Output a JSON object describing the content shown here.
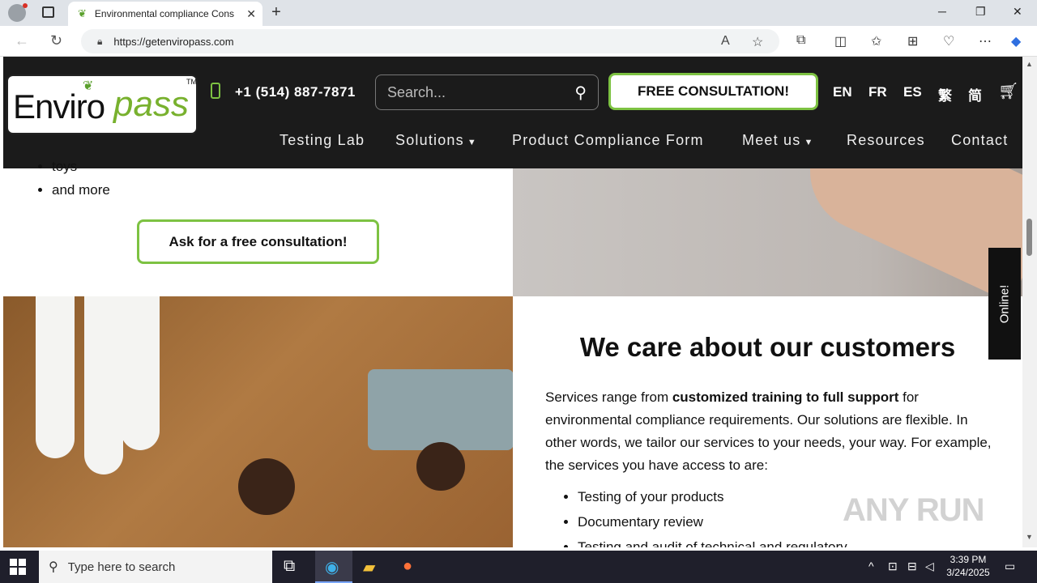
{
  "browser": {
    "tab_title": "Environmental compliance Cons",
    "url": "https://getenviropass.com",
    "tab_close": "✕",
    "new_tab": "+",
    "win_min": "─",
    "win_restore": "❐",
    "win_close": "✕"
  },
  "header": {
    "logo_left": "Enviro",
    "logo_right": "pass",
    "logo_tm": "TM",
    "phone": "+1 (514) 887-7871",
    "search_placeholder": "Search...",
    "cta": "FREE CONSULTATION!",
    "languages": [
      "EN",
      "FR",
      "ES",
      "繁",
      "简"
    ],
    "menu": [
      "Testing Lab",
      "Solutions",
      "Product Compliance Form",
      "Meet us",
      "Resources",
      "Contact"
    ]
  },
  "left_section": {
    "list": [
      "toys",
      "and more"
    ],
    "button": "Ask for a free consultation!"
  },
  "right_section": {
    "heading": "We care about our customers",
    "para_1": "Services range from ",
    "para_bold": "customized training to full support",
    "para_2": " for environmental compliance requirements. Our solutions are flexible. In other words, we tailor our services to your needs, your way. For example, the services you have access to are:",
    "list": [
      "Testing of your products",
      "Documentary review",
      "Testing and audit of technical and regulatory"
    ]
  },
  "widget": {
    "online": "Online!"
  },
  "watermark": "ANY RUN",
  "taskbar": {
    "search_placeholder": "Type here to search",
    "time": "3:39 PM",
    "date": "3/24/2025"
  },
  "icons": [
    "profile-icon",
    "tabs-icon",
    "leaf-icon",
    "back-icon",
    "refresh-icon",
    "lock-icon",
    "read-aloud-icon",
    "favorite-icon",
    "extensions-icon",
    "split-screen-icon",
    "favorites-icon",
    "collections-icon",
    "performance-icon",
    "more-icon",
    "copilot-icon",
    "phone-icon",
    "search-icon",
    "cart-icon",
    "windows-icon",
    "task-view-icon",
    "edge-icon",
    "file-explorer-icon",
    "firefox-icon"
  ]
}
